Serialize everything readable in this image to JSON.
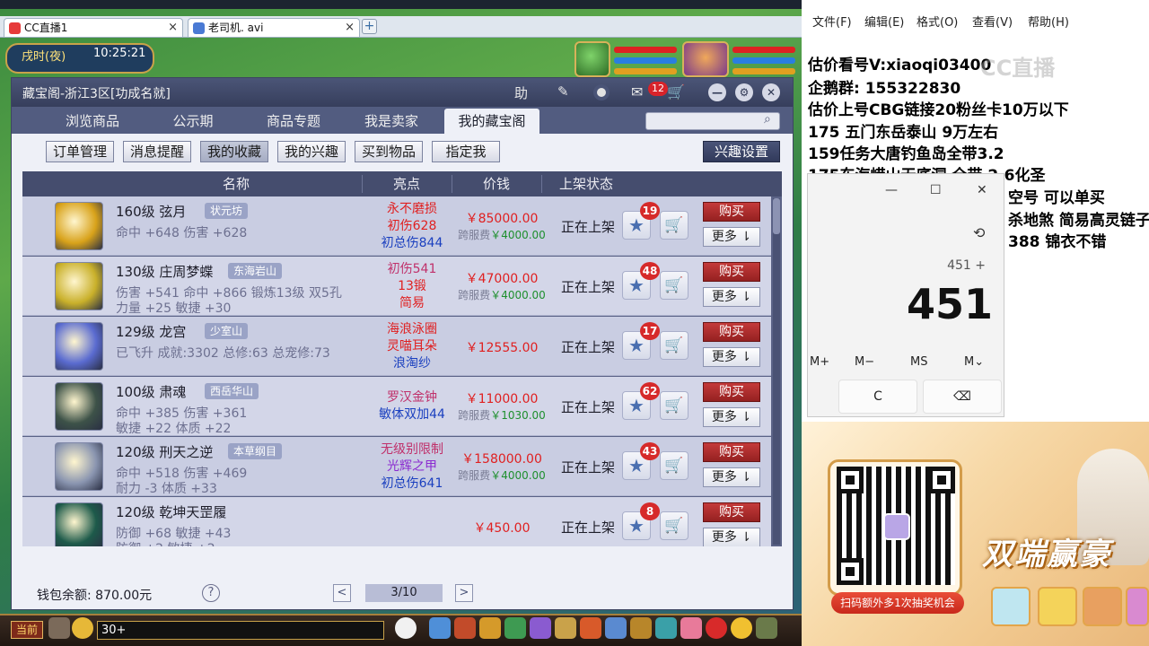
{
  "browser": {
    "tabs": [
      {
        "label": "CC直播1",
        "close": "×"
      },
      {
        "label": "老司机. avi",
        "close": "×"
      }
    ],
    "add_tab": "+"
  },
  "game": {
    "time_of_day": "戌时(夜)",
    "clock": "10:25:21",
    "chat_channel": "当前",
    "chat_input": "30+"
  },
  "panel": {
    "title": "藏宝阁-浙江3区[功成名就]",
    "help_label": "助",
    "message_count": "12",
    "nav_tabs": [
      "浏览商品",
      "公示期",
      "商品专题",
      "我是卖家",
      "我的藏宝阁"
    ],
    "active_nav": "我的藏宝阁",
    "sub_tabs": [
      "订单管理",
      "消息提醒",
      "我的收藏",
      "我的兴趣",
      "买到物品",
      "指定我"
    ],
    "active_sub": "我的收藏",
    "interest_settings": "兴趣设置",
    "columns": [
      "名称",
      "亮点",
      "价钱",
      "上架状态"
    ],
    "rows": [
      {
        "level_name": "160级 弦月",
        "server": "状元坊",
        "attr1": "命中 +648 伤害 +628",
        "attr2": "",
        "highlights": [
          "永不磨损",
          "初伤628",
          "初总伤844"
        ],
        "highlight_colors": [
          "#e02020",
          "#e02020",
          "#1a3fbf"
        ],
        "price": "￥85000.00",
        "fee_label": "跨服费",
        "fee_value": "￥4000.00",
        "status": "正在上架",
        "favorites": "19",
        "buy": "购买",
        "more": "更多 ⇂",
        "icon_color": "#d8a21a"
      },
      {
        "level_name": "130级 庄周梦蝶",
        "server": "东海岩山",
        "attr1": "伤害 +541 命中 +866 锻炼13级 双5孔",
        "attr2": "力量 +25 敏捷 +30",
        "highlights": [
          "初伤541",
          "13锻",
          "简易"
        ],
        "highlight_colors": [
          "#c0306a",
          "#e02020",
          "#e02020"
        ],
        "price": "￥47000.00",
        "fee_label": "跨服费",
        "fee_value": "￥4000.00",
        "status": "正在上架",
        "favorites": "48",
        "buy": "购买",
        "more": "更多 ⇂",
        "icon_color": "#c9b02a"
      },
      {
        "level_name": "129级 龙宫",
        "server": "少室山",
        "attr1": "已飞升 成就:3302 总修:63 总宠修:73",
        "attr2": "",
        "highlights": [
          "海浪泳圈",
          "灵喵耳朵",
          "浪淘纱"
        ],
        "highlight_colors": [
          "#e02020",
          "#e02020",
          "#1a3fbf"
        ],
        "price": "￥12555.00",
        "fee_label": "",
        "fee_value": "",
        "status": "正在上架",
        "favorites": "17",
        "buy": "购买",
        "more": "更多 ⇂",
        "icon_color": "#5a6bd0"
      },
      {
        "level_name": "100级 肃魂",
        "server": "西岳华山",
        "attr1": "命中 +385 伤害 +361",
        "attr2": "敏捷 +22 体质 +22",
        "highlights": [
          "罗汉金钟",
          "敏体双加44"
        ],
        "highlight_colors": [
          "#c0306a",
          "#1a3fbf"
        ],
        "price": "￥11000.00",
        "fee_label": "跨服费",
        "fee_value": "￥1030.00",
        "status": "正在上架",
        "favorites": "62",
        "buy": "购买",
        "more": "更多 ⇂",
        "icon_color": "#3d5248"
      },
      {
        "level_name": "120级 刑天之逆",
        "server": "本草纲目",
        "attr1": "命中 +518 伤害 +469",
        "attr2": "耐力 -3 体质 +33",
        "highlights": [
          "无级别限制",
          "光辉之甲",
          "初总伤641"
        ],
        "highlight_colors": [
          "#c0306a",
          "#8a2ad0",
          "#1a3fbf"
        ],
        "price": "￥158000.00",
        "fee_label": "跨服费",
        "fee_value": "￥4000.00",
        "status": "正在上架",
        "favorites": "43",
        "buy": "购买",
        "more": "更多 ⇂",
        "icon_color": "#8a95b0"
      },
      {
        "level_name": "120级 乾坤天罡履",
        "server": "",
        "attr1": "防御 +68 敏捷 +43",
        "attr2": "防御 +2 敏捷 +2",
        "highlights": [],
        "highlight_colors": [],
        "price": "￥450.00",
        "fee_label": "",
        "fee_value": "",
        "status": "正在上架",
        "favorites": "8",
        "buy": "购买",
        "more": "更多 ⇂",
        "icon_color": "#1d5a4a"
      }
    ],
    "wallet": "钱包余额: 870.00元",
    "help": "?",
    "page": "3/10",
    "prev": "<",
    "next": ">"
  },
  "notepad": {
    "menu": [
      "文件(F)",
      "编辑(E)",
      "格式(O)",
      "查看(V)",
      "帮助(H)"
    ],
    "lines": [
      "估价看号V:xiaoqi03400",
      "企鹅群: 155322830",
      "估价上号CBG链接20粉丝卡10万以下",
      "175 五门东岳泰山  9万左右",
      "159任务大唐钓鱼岛全带3.2",
      "175东海崂山无底洞  全带  2.6化圣",
      "空号 可以单买",
      "杀地煞 简易高灵链子",
      "388 锦衣不错"
    ],
    "watermark": "CC直播"
  },
  "calculator": {
    "expression": "451 +",
    "value": "451",
    "memory": [
      "M+",
      "M−",
      "MS",
      "M⌄"
    ],
    "keys": [
      "C",
      "⌫"
    ],
    "win_min": "—",
    "win_max": "☐",
    "win_close": "✕",
    "history_icon": "⟲"
  },
  "promo": {
    "qr_caption": "扫码额外多1次抽奖机会",
    "title": "双端赢豪"
  },
  "colors": {
    "panel_header": "#454d6e",
    "buy_red": "#c43a3a",
    "price_red": "#e02020",
    "fee_green": "#1e8f2e"
  }
}
